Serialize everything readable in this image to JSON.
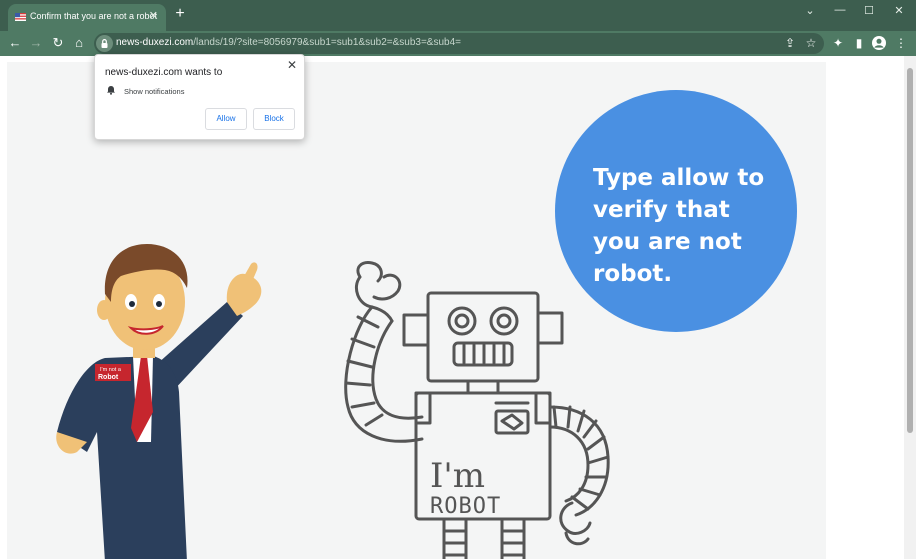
{
  "browser": {
    "tab_title": "Confirm that you are not a robot",
    "url_host": "news-duxezi.com",
    "url_path": "/lands/19/?site=8056979&sub1=sub1&sub2=&sub3=&sub4="
  },
  "prompt": {
    "title": "news-duxezi.com wants to",
    "permission": "Show notifications",
    "allow_label": "Allow",
    "block_label": "Block"
  },
  "page": {
    "bubble_text": "Type allow to verify that you are not robot.",
    "badge_line1": "I'm not a",
    "badge_line2": "Robot",
    "robot_chest_line1": "I'm",
    "robot_chest_line2": "ROBOT"
  },
  "colors": {
    "chrome_dark": "#3d5e4f",
    "chrome_light": "#4f7a64",
    "bubble": "#4a90e2",
    "button_text": "#1a73e8"
  }
}
